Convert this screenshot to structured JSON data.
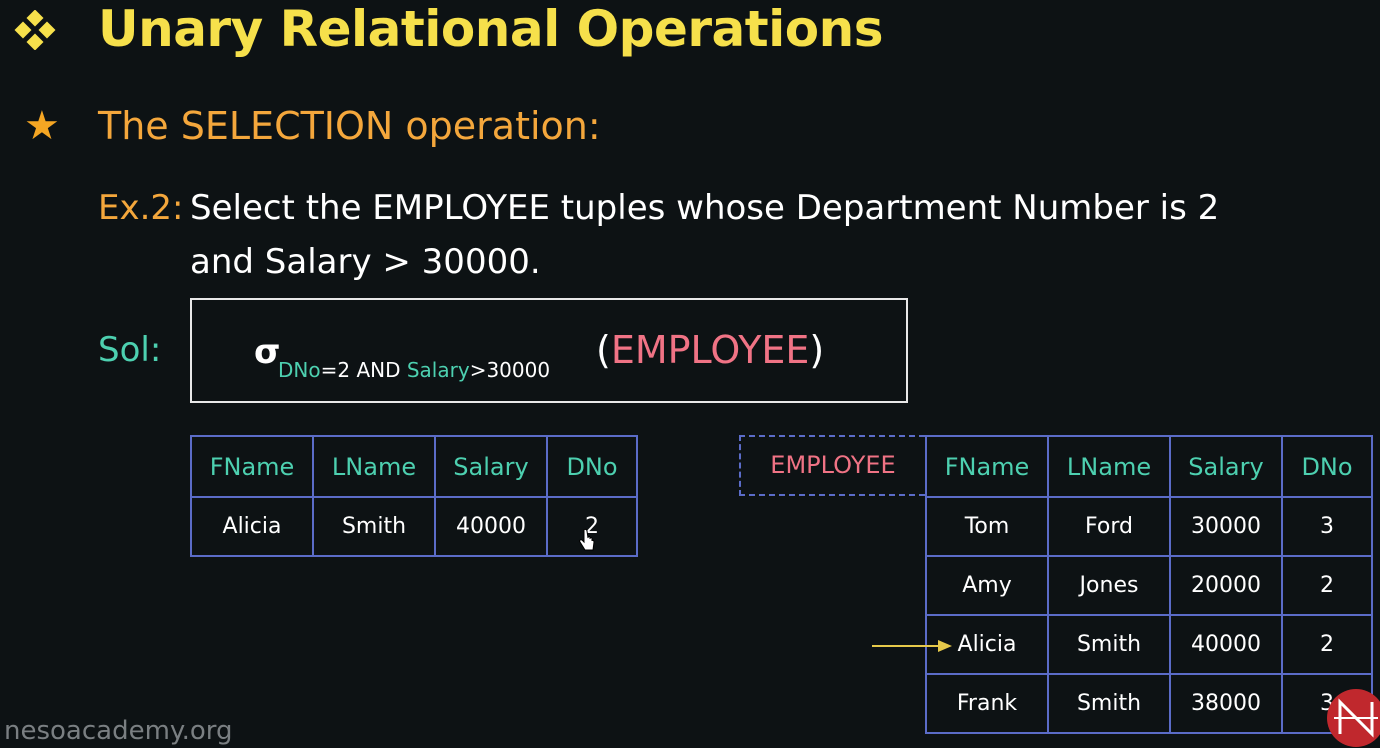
{
  "title": "Unary Relational Operations",
  "subtitle": "The SELECTION operation:",
  "example": {
    "label": "Ex.2:",
    "line1": "Select the EMPLOYEE tuples whose Department Number is 2",
    "line2": "and Salary > 30000."
  },
  "solution": {
    "label": "Sol:",
    "sigma": "σ",
    "cond_attr1": "DNo",
    "cond_mid": "=2 AND ",
    "cond_attr2": "Salary",
    "cond_end": ">30000",
    "paren_open": "(",
    "relation": "EMPLOYEE",
    "paren_close": ")"
  },
  "result_table": {
    "headers": [
      "FName",
      "LName",
      "Salary",
      "DNo"
    ],
    "rows": [
      [
        "Alicia",
        "Smith",
        "40000",
        "2"
      ]
    ]
  },
  "employee_table": {
    "label": "EMPLOYEE",
    "headers": [
      "FName",
      "LName",
      "Salary",
      "DNo"
    ],
    "rows": [
      [
        "Tom",
        "Ford",
        "30000",
        "3"
      ],
      [
        "Amy",
        "Jones",
        "20000",
        "2"
      ],
      [
        "Alicia",
        "Smith",
        "40000",
        "2"
      ],
      [
        "Frank",
        "Smith",
        "38000",
        "3"
      ]
    ]
  },
  "watermark": "nesoacademy.org",
  "colors": {
    "background": "#0d1214",
    "title": "#f6e04b",
    "accent_orange": "#f4a73c",
    "teal": "#4dd0b0",
    "pink": "#f07385",
    "table_border": "#5b6cc8",
    "arrow": "#e6c94a"
  },
  "icons": {
    "title_bullet": "diamond-cluster-icon",
    "subtitle_bullet": "star-icon",
    "pointer": "hand-cursor-icon",
    "highlight": "arrow-right-icon",
    "brand": "neso-logo-icon"
  }
}
